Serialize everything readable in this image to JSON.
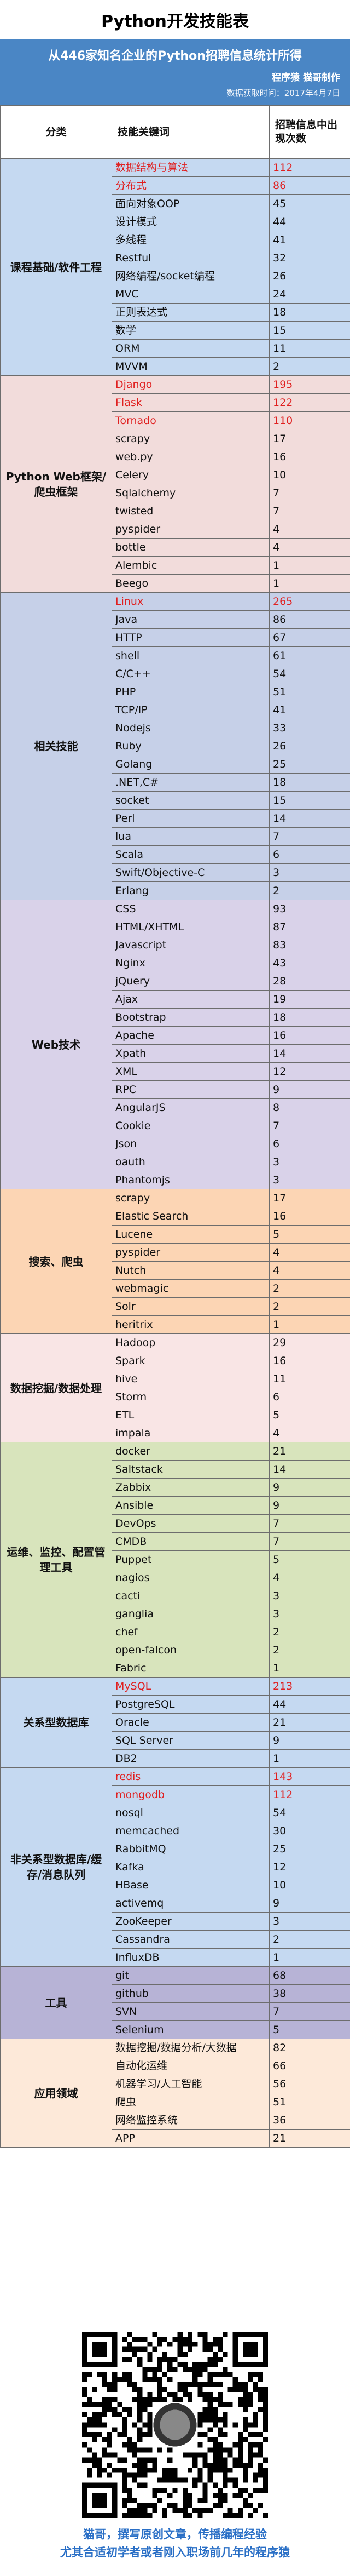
{
  "header": {
    "title": "Python开发技能表",
    "subtitle": "从446家知名企业的Python招聘信息统计所得",
    "author": "程序猿  猫哥制作",
    "date": "数据获取时间：2017年4月7日"
  },
  "columns": [
    "分类",
    "技能关键词",
    "招聘信息中出现次数"
  ],
  "colors": {
    "基础": "#c5d9f1",
    "web框架": "#f2dcdb",
    "相关技能": "#c6d0e8",
    "web技术": "#d9d2e9",
    "搜索": "#fcd5b4",
    "数据": "#f9e5e5",
    "运维": "#d8e4bc",
    "关系型": "#c5d9f1",
    "非关系型": "#c5d9f1",
    "工具": "#b7b3d6",
    "应用": "#fde9d9",
    "hot": "#e02020"
  },
  "groups": [
    {
      "category": "课程基础/软件工程",
      "color": "#c5d9f1",
      "rows": [
        [
          "数据结构与算法",
          "112",
          true
        ],
        [
          "分布式",
          "86",
          true
        ],
        [
          "面向对象OOP",
          "45",
          false
        ],
        [
          "设计模式",
          "44",
          false
        ],
        [
          "多线程",
          "41",
          false
        ],
        [
          "Restful",
          "32",
          false
        ],
        [
          "网络编程/socket编程",
          "26",
          false
        ],
        [
          "MVC",
          "24",
          false
        ],
        [
          "正则表达式",
          "18",
          false
        ],
        [
          "数学",
          "15",
          false
        ],
        [
          "ORM",
          "11",
          false
        ],
        [
          "MVVM",
          "2",
          false
        ]
      ]
    },
    {
      "category": "Python Web框架/爬虫框架",
      "color": "#f2dcdb",
      "rows": [
        [
          "Django",
          "195",
          true
        ],
        [
          "Flask",
          "122",
          true
        ],
        [
          "Tornado",
          "110",
          true
        ],
        [
          "scrapy",
          "17",
          false
        ],
        [
          "web.py",
          "16",
          false
        ],
        [
          "Celery",
          "10",
          false
        ],
        [
          "Sqlalchemy",
          "7",
          false
        ],
        [
          "twisted",
          "7",
          false
        ],
        [
          "pyspider",
          "4",
          false
        ],
        [
          "bottle",
          "4",
          false
        ],
        [
          "Alembic",
          "1",
          false
        ],
        [
          "Beego",
          "1",
          false
        ]
      ]
    },
    {
      "category": "相关技能",
      "color": "#c6d0e8",
      "rows": [
        [
          "Linux",
          "265",
          true
        ],
        [
          "Java",
          "86",
          false
        ],
        [
          "HTTP",
          "67",
          false
        ],
        [
          "shell",
          "61",
          false
        ],
        [
          "C/C++",
          "54",
          false
        ],
        [
          "PHP",
          "51",
          false
        ],
        [
          "TCP/IP",
          "41",
          false
        ],
        [
          "Nodejs",
          "33",
          false
        ],
        [
          "Ruby",
          "26",
          false
        ],
        [
          "Golang",
          "25",
          false
        ],
        [
          ".NET,C#",
          "18",
          false
        ],
        [
          "socket",
          "15",
          false
        ],
        [
          "Perl",
          "14",
          false
        ],
        [
          "lua",
          "7",
          false
        ],
        [
          "Scala",
          "6",
          false
        ],
        [
          "Swift/Objective-C",
          "3",
          false
        ],
        [
          "Erlang",
          "2",
          false
        ]
      ]
    },
    {
      "category": "Web技术",
      "color": "#d9d2e9",
      "rows": [
        [
          "CSS",
          "93",
          false
        ],
        [
          "HTML/XHTML",
          "87",
          false
        ],
        [
          "Javascript",
          "83",
          false
        ],
        [
          "Nginx",
          "43",
          false
        ],
        [
          "jQuery",
          "28",
          false
        ],
        [
          "Ajax",
          "19",
          false
        ],
        [
          "Bootstrap",
          "18",
          false
        ],
        [
          "Apache",
          "16",
          false
        ],
        [
          "Xpath",
          "14",
          false
        ],
        [
          "XML",
          "12",
          false
        ],
        [
          "RPC",
          "9",
          false
        ],
        [
          "AngularJS",
          "8",
          false
        ],
        [
          "Cookie",
          "7",
          false
        ],
        [
          "Json",
          "6",
          false
        ],
        [
          "oauth",
          "3",
          false
        ],
        [
          "Phantomjs",
          "3",
          false
        ]
      ]
    },
    {
      "category": "搜索、爬虫",
      "color": "#fcd5b4",
      "rows": [
        [
          "scrapy",
          "17",
          false
        ],
        [
          "Elastic Search",
          "16",
          false
        ],
        [
          "Lucene",
          "5",
          false
        ],
        [
          "pyspider",
          "4",
          false
        ],
        [
          "Nutch",
          "4",
          false
        ],
        [
          "webmagic",
          "2",
          false
        ],
        [
          "Solr",
          "2",
          false
        ],
        [
          "heritrix",
          "1",
          false
        ]
      ]
    },
    {
      "category": "数据挖掘/数据处理",
      "color": "#f9e5e5",
      "rows": [
        [
          "Hadoop",
          "29",
          false
        ],
        [
          "Spark",
          "16",
          false
        ],
        [
          "hive",
          "11",
          false
        ],
        [
          "Storm",
          "6",
          false
        ],
        [
          "ETL",
          "5",
          false
        ],
        [
          "impala",
          "4",
          false
        ]
      ]
    },
    {
      "category": "运维、监控、配置管理工具",
      "color": "#d8e4bc",
      "rows": [
        [
          "docker",
          "21",
          false
        ],
        [
          "Saltstack",
          "14",
          false
        ],
        [
          "Zabbix",
          "9",
          false
        ],
        [
          "Ansible",
          "9",
          false
        ],
        [
          "DevOps",
          "7",
          false
        ],
        [
          "CMDB",
          "7",
          false
        ],
        [
          "Puppet",
          "5",
          false
        ],
        [
          "nagios",
          "4",
          false
        ],
        [
          "cacti",
          "3",
          false
        ],
        [
          "ganglia",
          "3",
          false
        ],
        [
          "chef",
          "2",
          false
        ],
        [
          "open-falcon",
          "2",
          false
        ],
        [
          "Fabric",
          "1",
          false
        ]
      ]
    },
    {
      "category": "关系型数据库",
      "color": "#c5d9f1",
      "rows": [
        [
          "MySQL",
          "213",
          true
        ],
        [
          "PostgreSQL",
          "44",
          false
        ],
        [
          "Oracle",
          "21",
          false
        ],
        [
          "SQL Server",
          "9",
          false
        ],
        [
          "DB2",
          "1",
          false
        ]
      ]
    },
    {
      "category": "非关系型数据库/缓存/消息队列",
      "color": "#c5d9f1",
      "rows": [
        [
          "redis",
          "143",
          true
        ],
        [
          "mongodb",
          "112",
          true
        ],
        [
          "nosql",
          "54",
          false
        ],
        [
          "memcached",
          "30",
          false
        ],
        [
          "RabbitMQ",
          "25",
          false
        ],
        [
          "Kafka",
          "12",
          false
        ],
        [
          "HBase",
          "10",
          false
        ],
        [
          "activemq",
          "9",
          false
        ],
        [
          "ZooKeeper",
          "3",
          false
        ],
        [
          "Cassandra",
          "2",
          false
        ],
        [
          "InfluxDB",
          "1",
          false
        ]
      ]
    },
    {
      "category": "工具",
      "color": "#b7b3d6",
      "rows": [
        [
          "git",
          "68",
          false
        ],
        [
          "github",
          "38",
          false
        ],
        [
          "SVN",
          "7",
          false
        ],
        [
          "Selenium",
          "5",
          false
        ]
      ]
    },
    {
      "category": "应用领域",
      "color": "#fde9d9",
      "rows": [
        [
          "数据挖掘/数据分析/大数据",
          "82",
          false
        ],
        [
          "自动化运维",
          "66",
          false
        ],
        [
          "机器学习/人工智能",
          "56",
          false
        ],
        [
          "爬虫",
          "51",
          false
        ],
        [
          "网络监控系统",
          "36",
          false
        ],
        [
          "APP",
          "21",
          false
        ]
      ]
    }
  ],
  "footer": {
    "qr_label": "qr-code",
    "slogan_line1": "猫哥，撰写原创文章，传播编程经验",
    "slogan_line2": "尤其合适初学者或者刚入职场前几年的程序猿"
  }
}
